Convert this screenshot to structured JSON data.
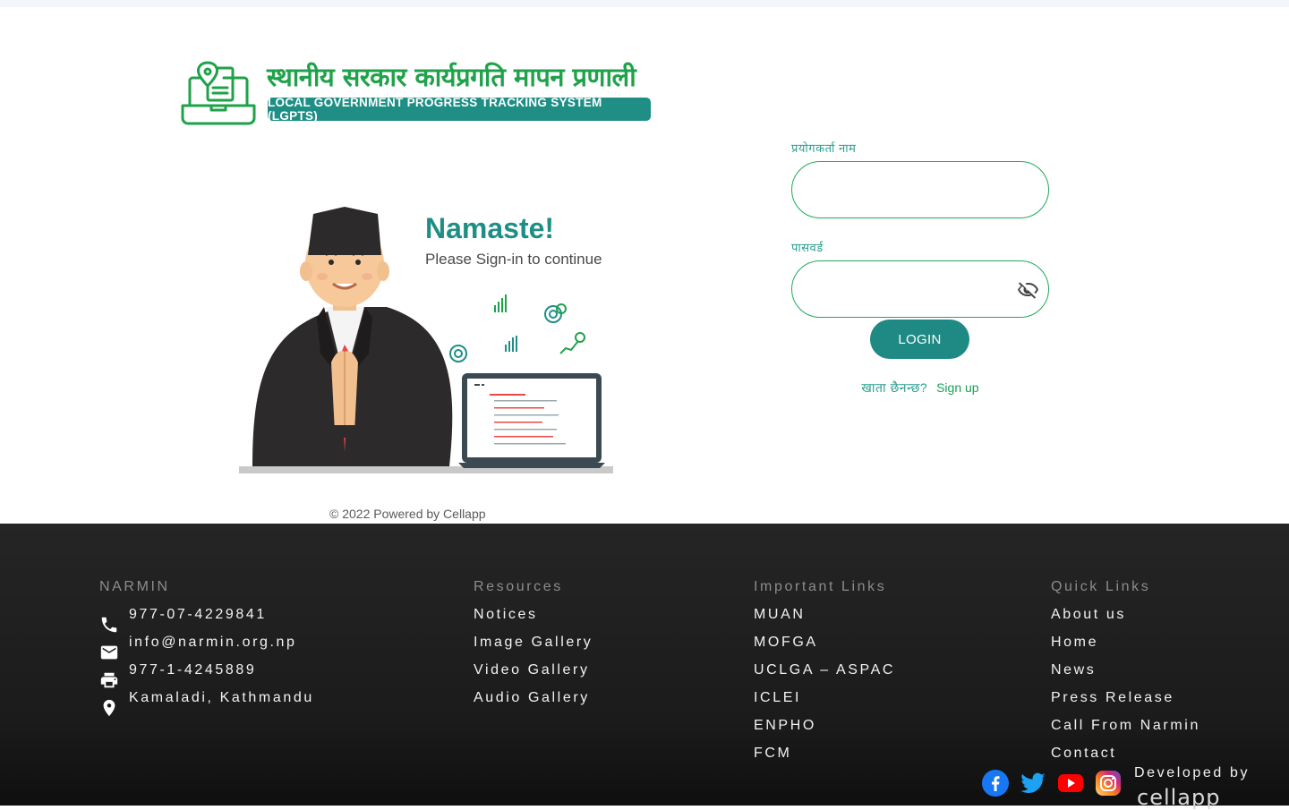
{
  "logo": {
    "nepali_title": "स्थानीय सरकार कार्यप्रगति मापन प्रणाली",
    "english_title": "LOCAL GOVERNMENT PROGRESS TRACKING SYSTEM (LGPTS)"
  },
  "illustration": {
    "greeting": "Namaste!",
    "subtitle": "Please Sign-in to continue"
  },
  "copyright": "© 2022 Powered by Cellapp",
  "form": {
    "username_label": "प्रयोगकर्ता नाम",
    "username_value": "",
    "password_label": "पासवर्ड",
    "password_value": "",
    "login_label": "LOGIN",
    "signup_question": "खाता छैनन्छ?",
    "signup_link": "Sign up"
  },
  "footer": {
    "narmin": {
      "title": "NARMIN",
      "phone": "977-07-4229841",
      "email": "info@narmin.org.np",
      "fax": "977-1-4245889",
      "address": "Kamaladi, Kathmandu"
    },
    "resources": {
      "title": "Resources",
      "items": [
        "Notices",
        "Image Gallery",
        "Video Gallery",
        "Audio Gallery"
      ]
    },
    "important_links": {
      "title": "Important Links",
      "items": [
        "MUAN",
        "MOFGA",
        "UCLGA – ASPAC",
        "ICLEI",
        "ENPHO",
        "FCM"
      ]
    },
    "quick_links": {
      "title": "Quick Links",
      "items": [
        "About us",
        "Home",
        "News",
        "Press Release",
        "Call From Narmin",
        "Contact"
      ]
    },
    "developed_by": "Developed by",
    "developer_logo": "cellapp",
    "social_icons": [
      "facebook-icon",
      "twitter-icon",
      "youtube-icon",
      "instagram-icon"
    ]
  },
  "colors": {
    "brand_green": "#1fa24a",
    "brand_teal": "#1f8f86",
    "footer_bg": "#222222"
  }
}
